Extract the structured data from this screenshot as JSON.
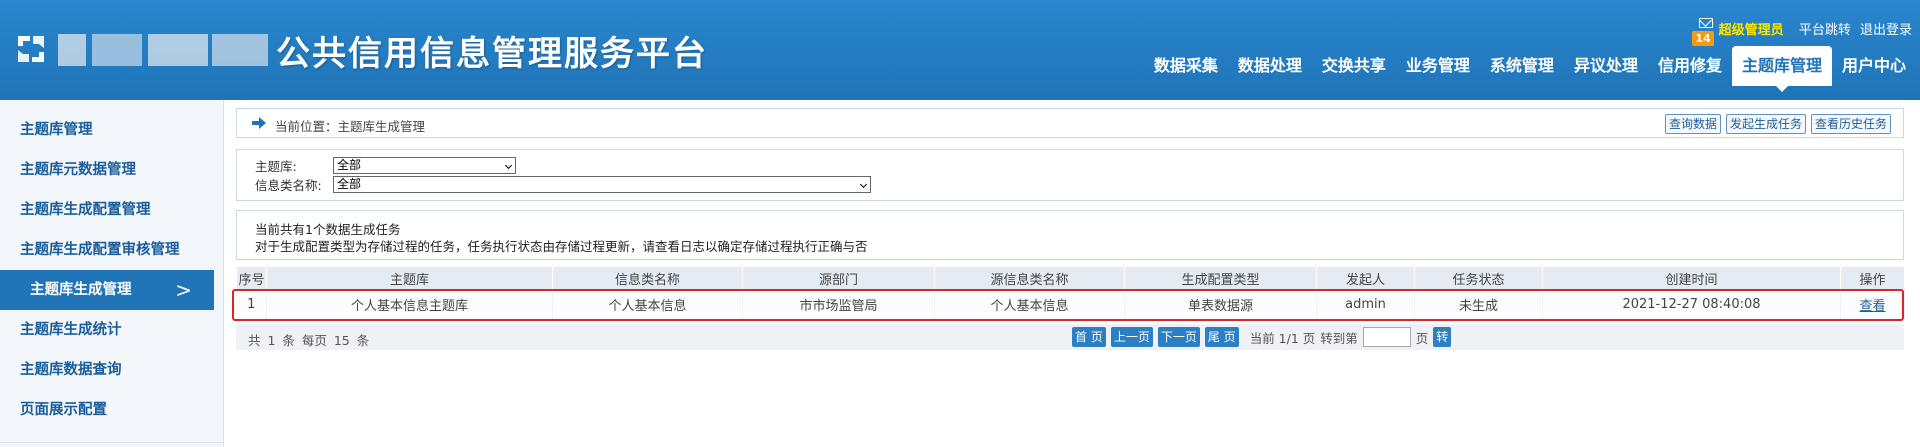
{
  "header": {
    "title": "公共信用信息管理服务平台",
    "mail_count": "14",
    "user_role": "超级管理员",
    "platform_jump": "平台跳转",
    "logout": "退出登录",
    "nav": [
      "数据采集",
      "数据处理",
      "交换共享",
      "业务管理",
      "系统管理",
      "异议处理",
      "信用修复",
      "主题库管理",
      "用户中心"
    ],
    "nav_active": "主题库管理"
  },
  "sidebar": {
    "items": [
      "主题库管理",
      "主题库元数据管理",
      "主题库生成配置管理",
      "主题库生成配置审核管理",
      "主题库生成管理",
      "主题库生成统计",
      "主题库数据查询",
      "页面展示配置"
    ],
    "active": "主题库生成管理",
    "chevron": ">"
  },
  "breadcrumb": {
    "text": "当前位置：主题库生成管理",
    "buttons": [
      "查询数据",
      "发起生成任务",
      "查看历史任务"
    ]
  },
  "filters": {
    "theme_label": "主题库:",
    "theme_value": "全部",
    "infotype_label": "信息类名称:",
    "infotype_value": "全部"
  },
  "info": {
    "line1": "当前共有1个数据生成任务",
    "line2": "对于生成配置类型为存储过程的任务，任务执行状态由存储过程更新，请查看日志以确定存储过程执行正确与否"
  },
  "table": {
    "columns": [
      "序号",
      "主题库",
      "信息类名称",
      "源部门",
      "源信息类名称",
      "生成配置类型",
      "发起人",
      "任务状态",
      "创建时间",
      "操作"
    ],
    "rows": [
      [
        "1",
        "个人基本信息主题库",
        "个人基本信息",
        "市市场监管局",
        "个人基本信息",
        "单表数据源",
        "admin",
        "未生成",
        "2021-12-27 08:40:08",
        "查看"
      ]
    ]
  },
  "pager": {
    "summary": "共 1 条  每页 15  条",
    "first": "首 页",
    "prev": "上一页",
    "next": "下一页",
    "last": "尾 页",
    "current": "当前 1/1 页",
    "goto_label": "转到第",
    "page_unit": "页",
    "go": "转"
  },
  "colors": {
    "header_bg": "#1f74b8",
    "sidebar_active": "#1f73b7",
    "highlight_border": "#d9262b",
    "admin_text": "#ffe600",
    "badge": "#f39c12"
  }
}
